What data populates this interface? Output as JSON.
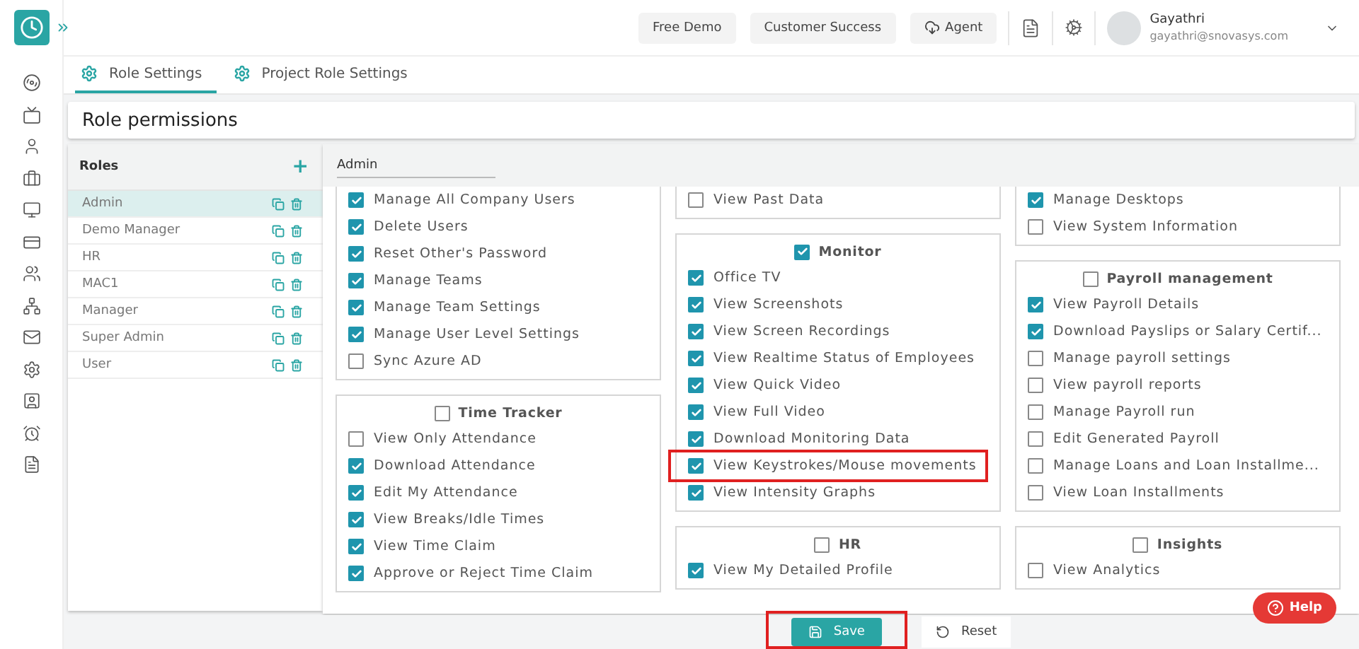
{
  "topbar": {
    "buttons": [
      {
        "label": "Free Demo",
        "kind": "plain"
      },
      {
        "label": "Customer Success",
        "kind": "plain"
      },
      {
        "label": "Agent",
        "kind": "cloud"
      }
    ],
    "user": {
      "name": "Gayathri",
      "email": "gayathri@snovasys.com"
    }
  },
  "tabs": [
    {
      "label": "Role Settings",
      "selected": true
    },
    {
      "label": "Project Role Settings",
      "selected": false
    }
  ],
  "page_title": "Role permissions",
  "roles": {
    "title": "Roles",
    "add": "+",
    "items": [
      {
        "name": "Admin",
        "selected": true
      },
      {
        "name": "Demo Manager",
        "selected": false
      },
      {
        "name": "HR",
        "selected": false
      },
      {
        "name": "MAC1",
        "selected": false
      },
      {
        "name": "Manager",
        "selected": false
      },
      {
        "name": "Super Admin",
        "selected": false
      },
      {
        "name": "User",
        "selected": false
      }
    ]
  },
  "selected_role": "Admin",
  "columns": [
    [
      {
        "items": [
          {
            "label": "Manage All Company Users",
            "checked": true,
            "highlighted": false
          },
          {
            "label": "Delete Users",
            "checked": true,
            "highlighted": false
          },
          {
            "label": "Reset Other's Password",
            "checked": true,
            "highlighted": false
          },
          {
            "label": "Manage Teams",
            "checked": true,
            "highlighted": false
          },
          {
            "label": "Manage Team Settings",
            "checked": true,
            "highlighted": false
          },
          {
            "label": "Manage User Level Settings",
            "checked": true,
            "highlighted": false
          },
          {
            "label": "Sync Azure AD",
            "checked": false,
            "highlighted": false
          }
        ]
      },
      {
        "title": "Time Tracker",
        "checked": false,
        "items": [
          {
            "label": "View Only Attendance",
            "checked": false,
            "highlighted": false
          },
          {
            "label": "Download Attendance",
            "checked": true,
            "highlighted": false
          },
          {
            "label": "Edit My Attendance",
            "checked": true,
            "highlighted": false
          },
          {
            "label": "View Breaks/Idle Times",
            "checked": true,
            "highlighted": false
          },
          {
            "label": "View Time Claim",
            "checked": true,
            "highlighted": false
          },
          {
            "label": "Approve or Reject Time Claim",
            "checked": true,
            "highlighted": false
          }
        ]
      }
    ],
    [
      {
        "items": [
          {
            "label": "View Past Data",
            "checked": false,
            "highlighted": false
          }
        ]
      },
      {
        "title": "Monitor",
        "checked": true,
        "items": [
          {
            "label": "Office TV",
            "checked": true,
            "highlighted": false
          },
          {
            "label": "View Screenshots",
            "checked": true,
            "highlighted": false
          },
          {
            "label": "View Screen Recordings",
            "checked": true,
            "highlighted": false
          },
          {
            "label": "View Realtime Status of Employees",
            "checked": true,
            "highlighted": false
          },
          {
            "label": "View Quick Video",
            "checked": true,
            "highlighted": false
          },
          {
            "label": "View Full Video",
            "checked": true,
            "highlighted": false
          },
          {
            "label": "Download Monitoring Data",
            "checked": true,
            "highlighted": false
          },
          {
            "label": "View Keystrokes/Mouse movements",
            "checked": true,
            "highlighted": true
          },
          {
            "label": "View Intensity Graphs",
            "checked": true,
            "highlighted": false
          }
        ]
      },
      {
        "title": "HR",
        "checked": false,
        "items": [
          {
            "label": "View My Detailed Profile",
            "checked": true,
            "highlighted": false
          }
        ]
      }
    ],
    [
      {
        "items": [
          {
            "label": "Manage Desktops",
            "checked": true,
            "highlighted": false
          },
          {
            "label": "View System Information",
            "checked": false,
            "highlighted": false
          }
        ]
      },
      {
        "title": "Payroll management",
        "checked": false,
        "items": [
          {
            "label": "View Payroll Details",
            "checked": true,
            "highlighted": false
          },
          {
            "label": "Download Payslips or Salary Certif...",
            "checked": true,
            "highlighted": false
          },
          {
            "label": "Manage payroll settings",
            "checked": false,
            "highlighted": false
          },
          {
            "label": "View payroll reports",
            "checked": false,
            "highlighted": false
          },
          {
            "label": "Manage Payroll run",
            "checked": false,
            "highlighted": false
          },
          {
            "label": "Edit Generated Payroll",
            "checked": false,
            "highlighted": false
          },
          {
            "label": "Manage Loans and Loan Installme...",
            "checked": false,
            "highlighted": false
          },
          {
            "label": "View Loan Installments",
            "checked": false,
            "highlighted": false
          }
        ]
      },
      {
        "title": "Insights",
        "checked": false,
        "items": [
          {
            "label": "View Analytics",
            "checked": false,
            "highlighted": false
          }
        ]
      }
    ]
  ],
  "footer": {
    "save": "Save",
    "save_highlighted": true,
    "reset": "Reset"
  },
  "help": "Help"
}
